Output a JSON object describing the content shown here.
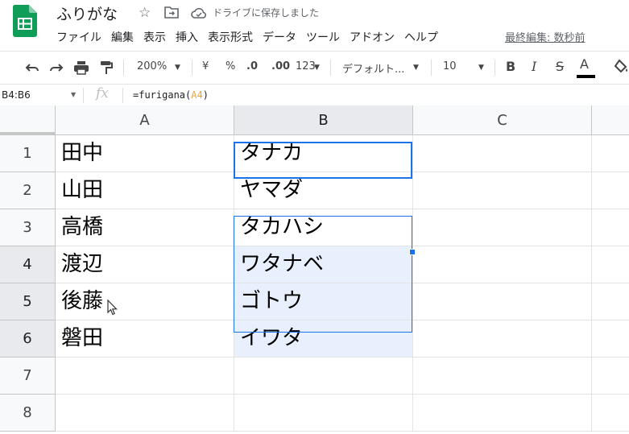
{
  "header": {
    "doc_title": "ふりがな",
    "saved_status": "ドライブに保存しました",
    "last_edit": "最終編集: 数秒前"
  },
  "menu": [
    "ファイル",
    "編集",
    "表示",
    "挿入",
    "表示形式",
    "データ",
    "ツール",
    "アドオン",
    "ヘルプ"
  ],
  "toolbar": {
    "zoom": "200%",
    "currency": "¥",
    "percent": "%",
    "dec_decrease": ".0",
    "dec_increase": ".00",
    "more_formats": "123",
    "font": "デフォルト...",
    "font_size": "10",
    "bold": "B",
    "italic": "I",
    "strike": "S",
    "text_color": "A"
  },
  "formula_bar": {
    "name_box": "B4:B6",
    "fx": "fx",
    "formula_prefix": "=furigana(",
    "formula_ref": "A4",
    "formula_suffix": ")"
  },
  "grid": {
    "columns": [
      "A",
      "B",
      "C"
    ],
    "rows": [
      "1",
      "2",
      "3",
      "4",
      "5",
      "6",
      "7",
      "8"
    ],
    "col_a": [
      "田中",
      "山田",
      "高橋",
      "渡辺",
      "後藤",
      "磐田",
      "",
      ""
    ],
    "col_b": [
      "タナカ",
      "ヤマダ",
      "タカハシ",
      "ワタナベ",
      "ゴトウ",
      "イワタ",
      "",
      ""
    ],
    "col_c": [
      "",
      "",
      "",
      "",
      "",
      "",
      "",
      ""
    ]
  },
  "colors": {
    "selection_border": "#1a73e8",
    "selection_fill": "#e8f0fe",
    "logo_green": "#0f9d58",
    "ref_highlight": "#e8a33d"
  }
}
